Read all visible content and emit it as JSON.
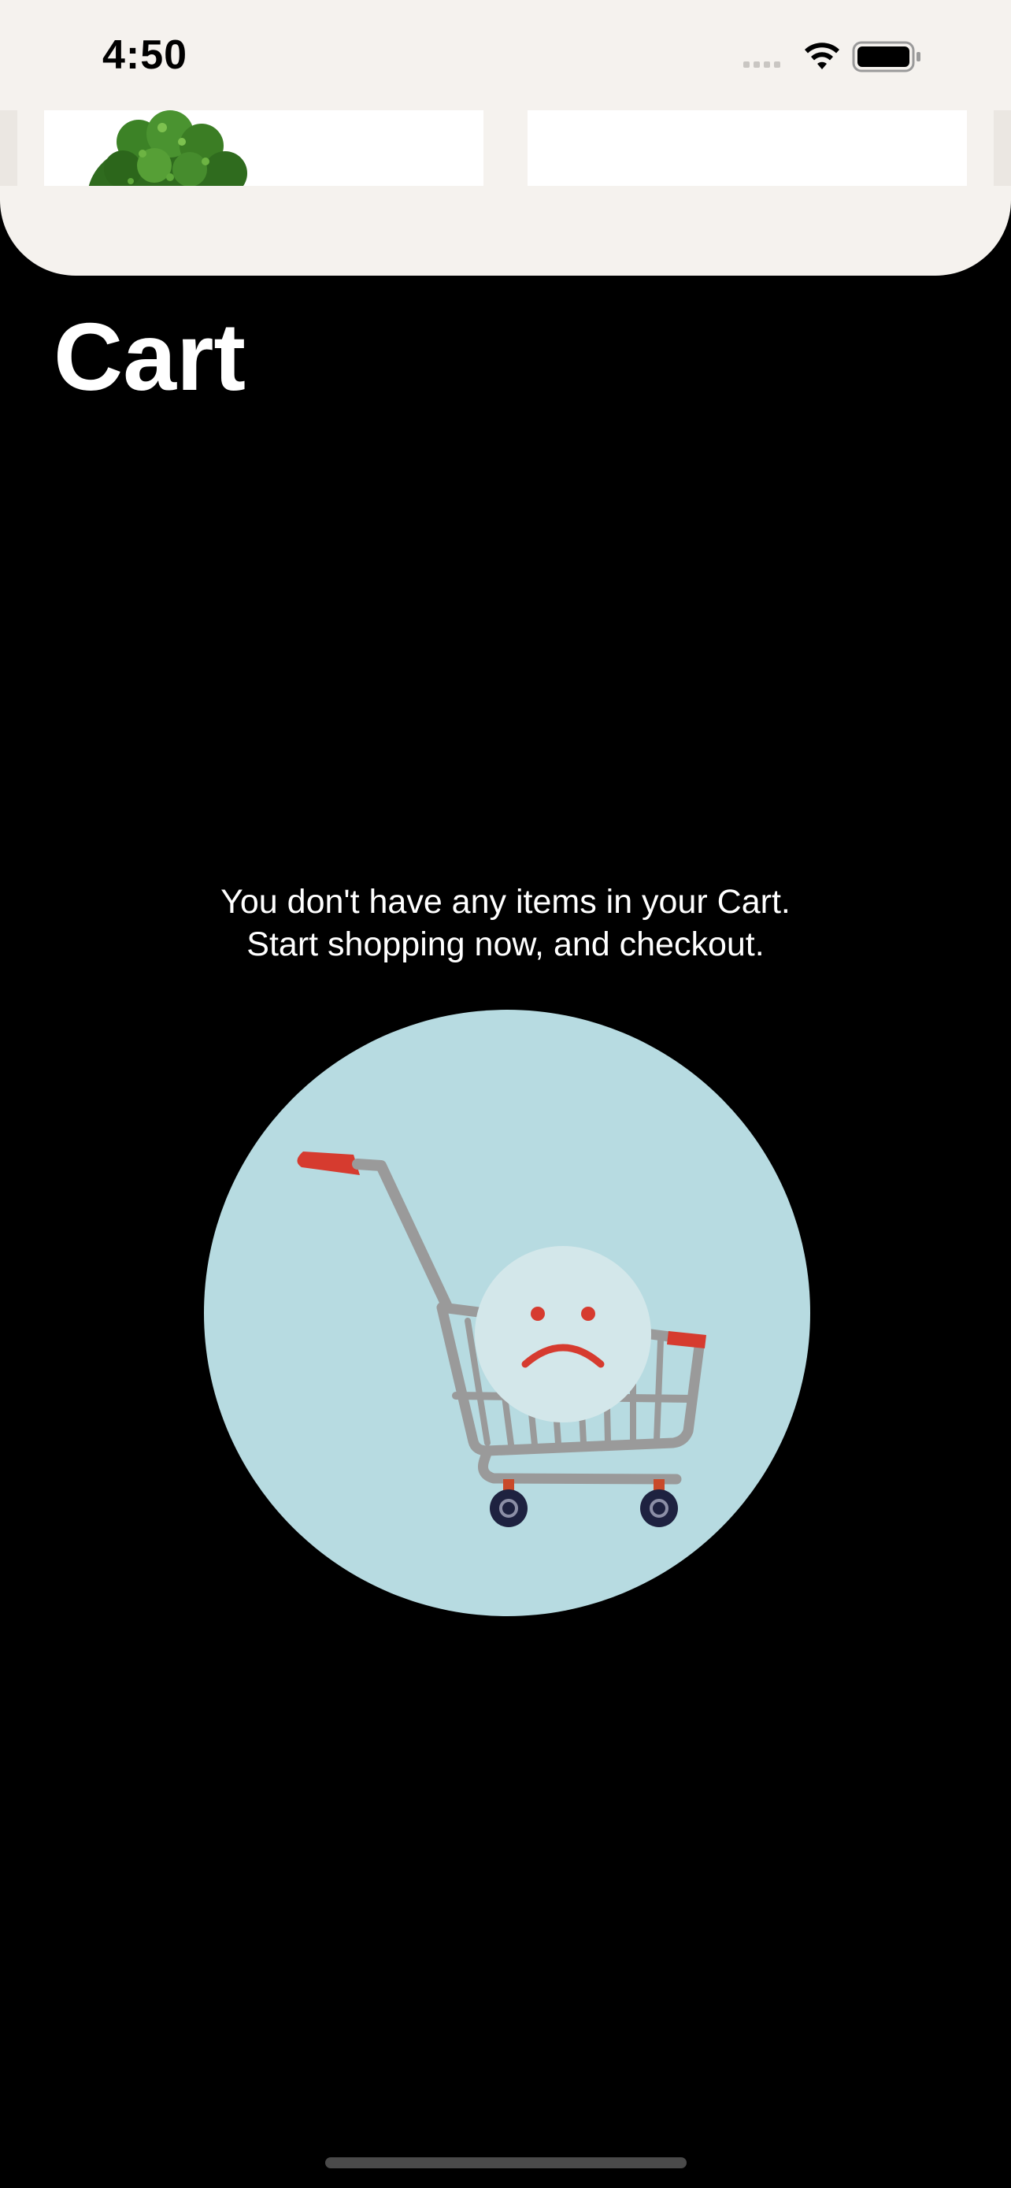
{
  "status_bar": {
    "time": "4:50",
    "icons": [
      "cellular-signal-icon",
      "wifi-icon",
      "battery-icon"
    ]
  },
  "product_strip": {
    "items": [
      {
        "image": "broccoli"
      },
      {
        "image": "blank"
      }
    ]
  },
  "page": {
    "title": "Cart"
  },
  "empty_state": {
    "line1": "You don't have any items in your Cart.",
    "line2": "Start shopping now, and checkout.",
    "illustration": "sad-shopping-cart"
  },
  "colors": {
    "sheet_background": "#f5f2ee",
    "page_background": "#000000",
    "illustration_circle": "#b7dbe1",
    "accent_red": "#d63b2f"
  }
}
